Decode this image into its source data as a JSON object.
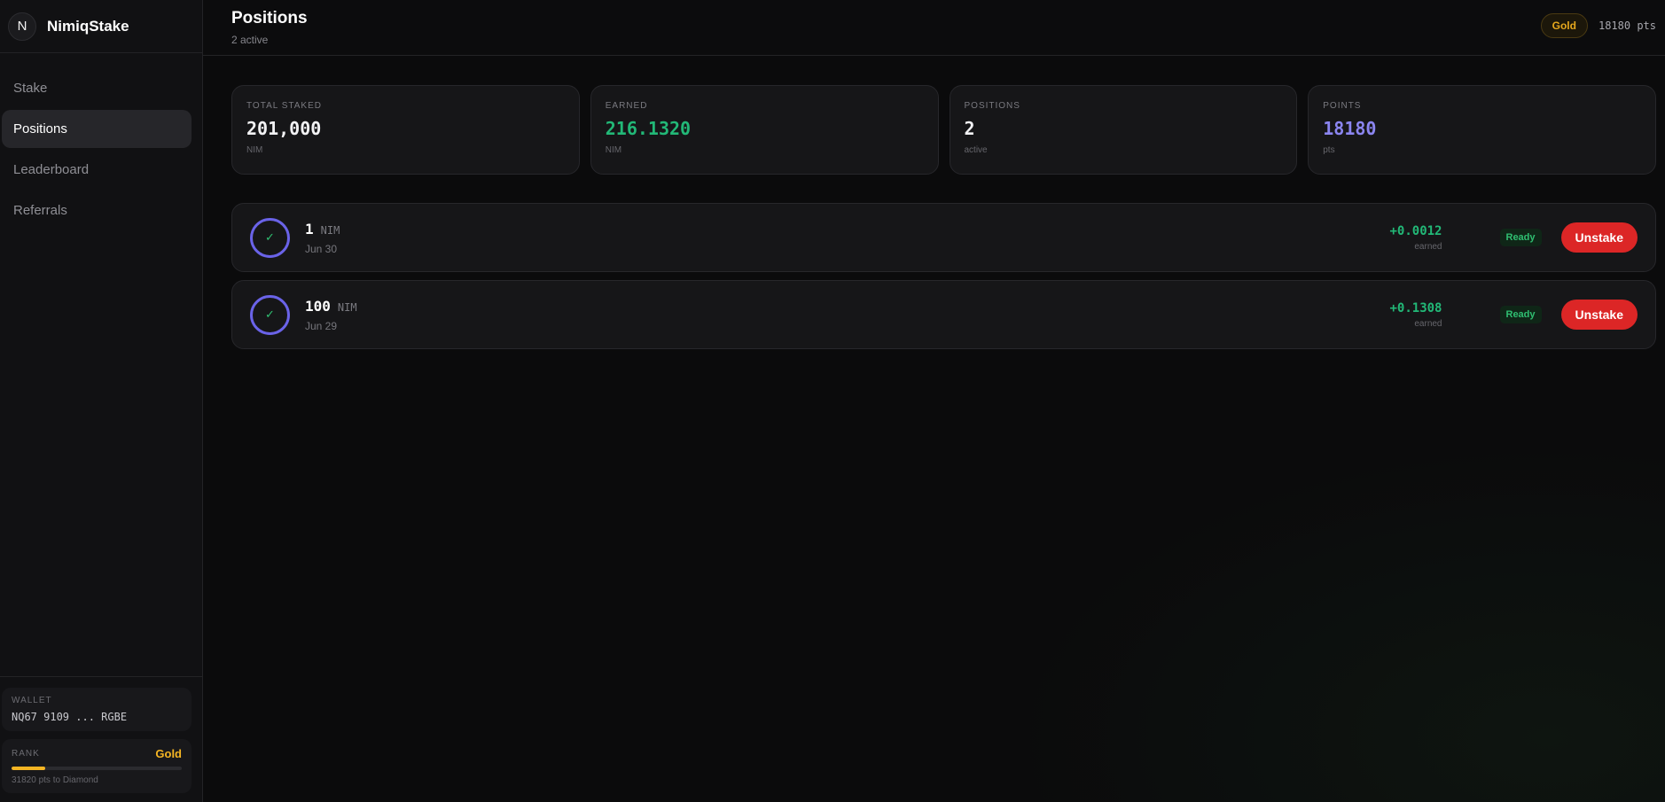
{
  "brand": {
    "logo_letter": "N",
    "name": "NimiqStake"
  },
  "nav": {
    "items": [
      {
        "label": "Stake"
      },
      {
        "label": "Positions",
        "active": true
      },
      {
        "label": "Leaderboard"
      },
      {
        "label": "Referrals"
      }
    ]
  },
  "wallet": {
    "label": "WALLET",
    "address": "NQ67 9109 ... RGBE"
  },
  "rank": {
    "label": "RANK",
    "tier": "Gold",
    "progress_fraction": 0.2,
    "subtext": "31820 pts to Diamond"
  },
  "header": {
    "title": "Positions",
    "subtitle": "2 active",
    "tier_badge": "Gold",
    "points": "18180 pts"
  },
  "stats": [
    {
      "label": "TOTAL STAKED",
      "value": "201,000",
      "unit": "NIM",
      "color": "#f2f2f4"
    },
    {
      "label": "EARNED",
      "value": "216.1320",
      "unit": "NIM",
      "color": "#22b877"
    },
    {
      "label": "POSITIONS",
      "value": "2",
      "unit": "active",
      "color": "#f2f2f4"
    },
    {
      "label": "POINTS",
      "value": "18180",
      "unit": "pts",
      "color": "#8b85f0"
    }
  ],
  "positions": [
    {
      "amount": "1",
      "unit": "NIM",
      "date": "Jun 30",
      "earned": "+0.0012",
      "earned_label": "earned",
      "status": "Ready",
      "action": "Unstake",
      "icon": "check-icon"
    },
    {
      "amount": "100",
      "unit": "NIM",
      "date": "Jun 29",
      "earned": "+0.1308",
      "earned_label": "earned",
      "status": "Ready",
      "action": "Unstake",
      "icon": "check-icon"
    }
  ],
  "colors": {
    "accent_purple": "#6a63e8",
    "success": "#2fbf71",
    "danger": "#dc2626",
    "gold": "#f5b523"
  }
}
